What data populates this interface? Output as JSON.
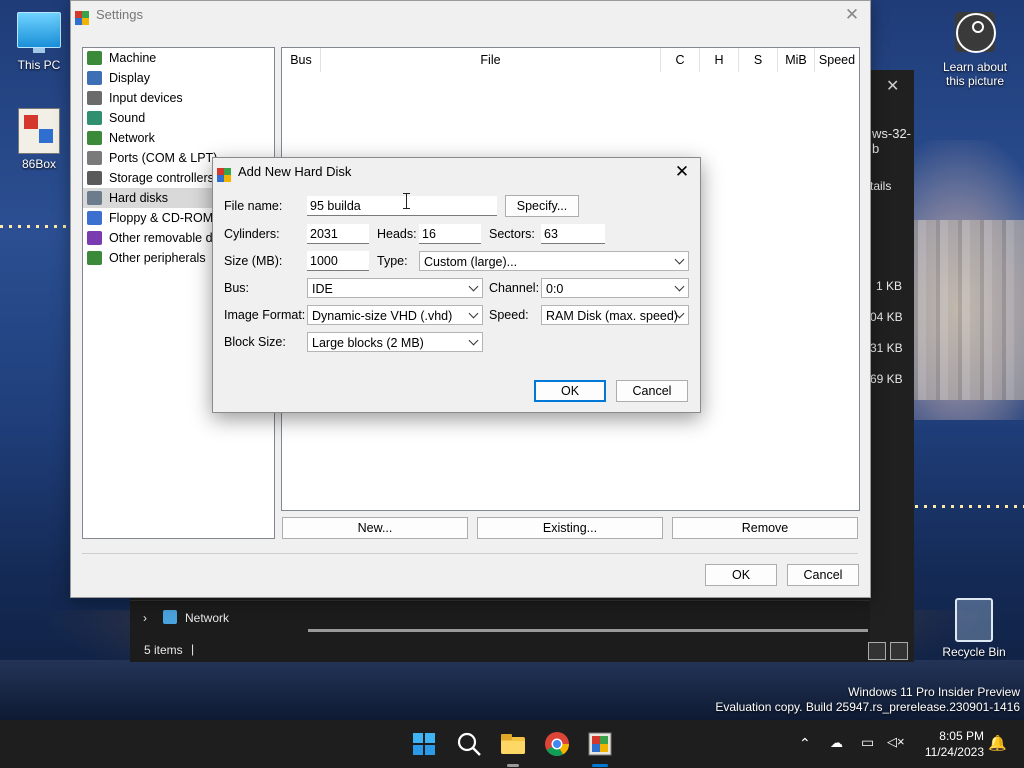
{
  "desktop": {
    "icons": [
      {
        "label": "This PC"
      },
      {
        "label": "86Box"
      },
      {
        "label": "Recycle Bin"
      }
    ],
    "learn": {
      "line1": "Learn about",
      "line2": "this picture"
    },
    "watermark": {
      "line1": "Windows 11 Pro Insider Preview",
      "line2": "Evaluation copy. Build 25947.rs_prerelease.230901-1416"
    }
  },
  "explorer": {
    "title_fragment": "ws-32-b",
    "details_fragment": "tails",
    "sizes": [
      "1 KB",
      "04 KB",
      "31 KB",
      "69 KB"
    ],
    "network_label": "Network",
    "status": "5 items"
  },
  "settings": {
    "title": "Settings",
    "tree": [
      {
        "label": "Machine",
        "color": "#3a8a3a"
      },
      {
        "label": "Display",
        "color": "#3d6fb5"
      },
      {
        "label": "Input devices",
        "color": "#6b6b6b"
      },
      {
        "label": "Sound",
        "color": "#2f8f6f"
      },
      {
        "label": "Network",
        "color": "#3a8a3a"
      },
      {
        "label": "Ports (COM & LPT)",
        "color": "#7a7a7a"
      },
      {
        "label": "Storage controllers",
        "color": "#5a5a5a"
      },
      {
        "label": "Hard disks",
        "color": "#6c7c8c"
      },
      {
        "label": "Floppy & CD-ROM d",
        "color": "#3b6fd0"
      },
      {
        "label": "Other removable de",
        "color": "#7b3bb0"
      },
      {
        "label": "Other peripherals",
        "color": "#3a8a3a"
      }
    ],
    "selected_index": 7,
    "columns": [
      "Bus",
      "File",
      "C",
      "H",
      "S",
      "MiB",
      "Speed"
    ],
    "buttons": {
      "new": "New...",
      "existing": "Existing...",
      "remove": "Remove",
      "ok": "OK",
      "cancel": "Cancel"
    }
  },
  "dialog": {
    "title": "Add New Hard Disk",
    "file_name_label": "File name:",
    "file_name_value": "95 builda",
    "specify": "Specify...",
    "cylinders_label": "Cylinders:",
    "cylinders_value": "2031",
    "heads_label": "Heads:",
    "heads_value": "16",
    "sectors_label": "Sectors:",
    "sectors_value": "63",
    "size_label": "Size (MB):",
    "size_value": "1000",
    "type_label": "Type:",
    "type_value": "Custom (large)...",
    "bus_label": "Bus:",
    "bus_value": "IDE",
    "channel_label": "Channel:",
    "channel_value": "0:0",
    "image_format_label": "Image Format:",
    "image_format_value": "Dynamic-size VHD (.vhd)",
    "speed_label": "Speed:",
    "speed_value": "RAM Disk (max. speed)",
    "block_size_label": "Block Size:",
    "block_size_value": "Large blocks (2 MB)",
    "ok": "OK",
    "cancel": "Cancel"
  },
  "taskbar": {
    "time": "8:05 PM",
    "date": "11/24/2023",
    "accent": "#0078d4"
  }
}
